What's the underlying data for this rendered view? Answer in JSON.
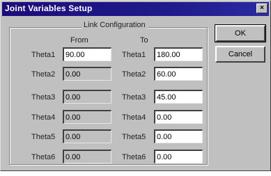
{
  "window": {
    "title": "Joint Variables Setup",
    "close_glyph": "×"
  },
  "group": {
    "title": "Link Configuration",
    "from_header": "From",
    "to_header": "To"
  },
  "rows": [
    {
      "from_label": "Theta1",
      "from_value": "90.00",
      "to_label": "Theta1",
      "to_value": "180.00"
    },
    {
      "from_label": "Theta2",
      "from_value": "0.00",
      "to_label": "Theta2",
      "to_value": "60.00"
    },
    {
      "from_label": "Theta3",
      "from_value": "0.00",
      "to_label": "Theta3",
      "to_value": "45.00"
    },
    {
      "from_label": "Theta4",
      "from_value": "0.00",
      "to_label": "Theta4",
      "to_value": "0.00"
    },
    {
      "from_label": "Theta5",
      "from_value": "0.00",
      "to_label": "Theta5",
      "to_value": "0.00"
    },
    {
      "from_label": "Theta6",
      "from_value": "0.00",
      "to_label": "Theta6",
      "to_value": "0.00"
    }
  ],
  "buttons": {
    "ok": "OK",
    "cancel": "Cancel"
  },
  "colors": {
    "titlebar": "#1c0d7a",
    "face": "#c0c0c0"
  }
}
